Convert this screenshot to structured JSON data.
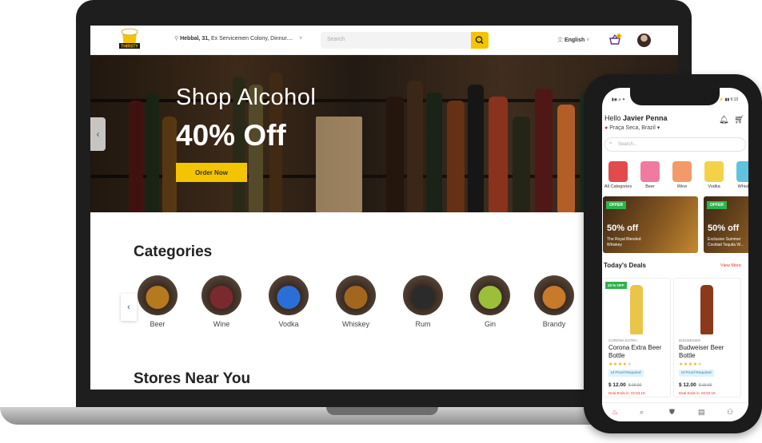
{
  "web": {
    "header": {
      "logo_text": "THIRSTY",
      "location_prefix": "Hebbal, 31,",
      "location_rest": " Ex Servicemen Colony, Dinnur....",
      "location_chevron": "˅",
      "search_placeholder": "Search",
      "language": "English",
      "language_chevron": "˅",
      "cart_count": "2"
    },
    "hero": {
      "title": "Shop Alcohol",
      "discount": "40% Off",
      "cta": "Order Now",
      "prev_arrow": "‹"
    },
    "categories": {
      "title": "Categories",
      "prev_arrow": "‹",
      "items": [
        {
          "label": "Beer",
          "color": "#b5791e"
        },
        {
          "label": "Wine",
          "color": "#7a2a2f"
        },
        {
          "label": "Vodka",
          "color": "#2a6fd6"
        },
        {
          "label": "Whiskey",
          "color": "#a3661f"
        },
        {
          "label": "Rum",
          "color": "#2b2b2b"
        },
        {
          "label": "Gin",
          "color": "#9cbf3a"
        },
        {
          "label": "Brandy",
          "color": "#c67a2a"
        }
      ]
    },
    "stores_title": "Stores Near You"
  },
  "mobile": {
    "status": {
      "left": "▮◉ ⌀ ✦",
      "right": "⚡ ▮▮ 6:10"
    },
    "greeting_prefix": "Hello ",
    "user_name": "Javier Penna",
    "location": "Praça Seca, Brazil",
    "location_chevron": "▾",
    "search_placeholder": "Search...",
    "categories": [
      {
        "label": "All Categories",
        "color": "#e24b4b"
      },
      {
        "label": "Beer",
        "color": "#f07aa0"
      },
      {
        "label": "Wine",
        "color": "#f29a6a"
      },
      {
        "label": "Vodka",
        "color": "#f3d24a"
      },
      {
        "label": "Whiskey",
        "color": "#5fc3e0"
      }
    ],
    "offers": [
      {
        "tag": "OFFER",
        "pct": "50% off",
        "name": "The Royal Blended Whiskey"
      },
      {
        "tag": "OFFER",
        "pct": "50% off",
        "name": "Exclusive Summer Cocktail Tequila W..."
      }
    ],
    "deals_title": "Today's Deals",
    "view_more": "View More",
    "products": [
      {
        "tag": "10 % OFF",
        "brand": "CORONA EXTRA",
        "name": "Corona Extra Beer Bottle",
        "stars_on": "★★★★",
        "stars_off": "★",
        "proof": "Id Proof Required",
        "price": "$ 12.00",
        "old_price": "$ 15.00",
        "deal": "Deal Ends in: 02:53:19",
        "bottle_color": "#e9c54a"
      },
      {
        "tag": "",
        "brand": "BUDWEISER",
        "name": "Budweiser Beer Bottle",
        "stars_on": "★★★★",
        "stars_off": "★",
        "proof": "Id Proof Required",
        "price": "$ 12.00",
        "old_price": "$ 15.00",
        "deal": "Deal Ends in: 02:53:19",
        "bottle_color": "#8a3a1a"
      }
    ],
    "tabs": {
      "home": "♨",
      "search": "⌕",
      "bag": "⛊",
      "orders": "▤",
      "profile": "⚇"
    }
  }
}
